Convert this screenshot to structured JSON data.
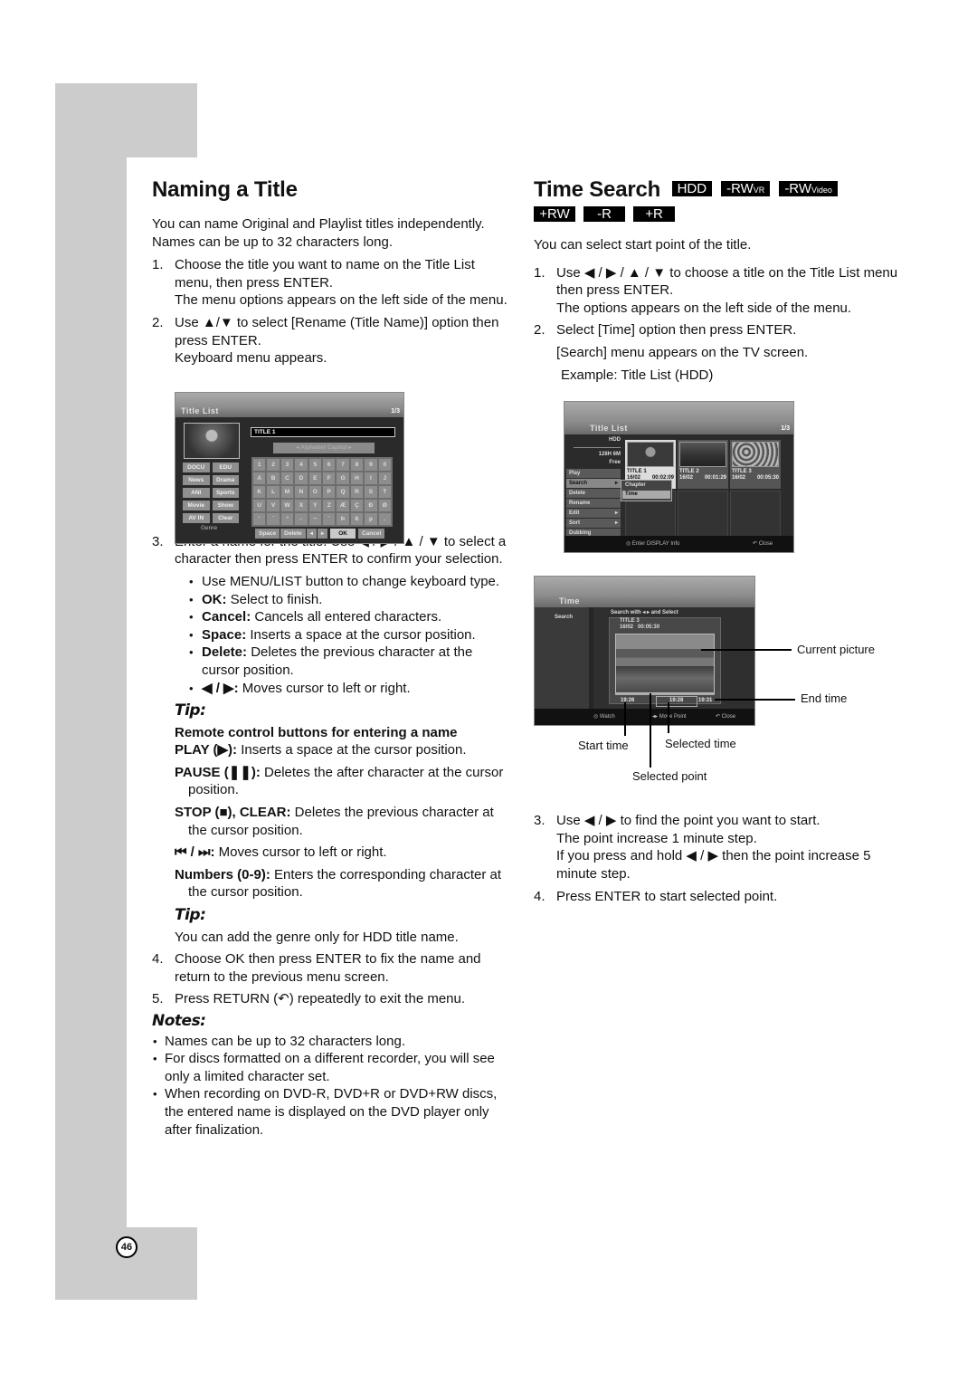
{
  "page_number": "46",
  "left": {
    "title": "Naming a Title",
    "intro": "You can name Original and Playlist titles independently. Names can be up to 32 characters long.",
    "steps": [
      {
        "num": "1.",
        "text": "Choose the title you want to name on the Title List menu, then press ENTER.",
        "sub": "The menu options appears on the left side of the menu."
      },
      {
        "num": "2.",
        "text": "Use ▲/▼ to select [Rename (Title Name)] option then press ENTER.",
        "sub": "Keyboard menu appears."
      },
      {
        "num": "3.",
        "text": "Enter a name for the title. Use ◀ / ▶ / ▲ / ▼ to select a character then press ENTER to confirm your selection."
      },
      {
        "num": "4.",
        "text": "Choose OK then press ENTER to fix the name and return to the previous menu screen."
      },
      {
        "num": "5.",
        "text": "Press RETURN (↶) repeatedly to exit the menu."
      }
    ],
    "step3_bullets": [
      {
        "bold": "",
        "text": "Use MENU/LIST button to change keyboard type."
      },
      {
        "bold": "OK:",
        "text": " Select to finish."
      },
      {
        "bold": "Cancel:",
        "text": " Cancels all entered characters."
      },
      {
        "bold": "Space:",
        "text": " Inserts a space at the cursor position."
      },
      {
        "bold": "Delete:",
        "text": " Deletes the previous character at the cursor position."
      },
      {
        "bold": "◀ / ▶:",
        "text": " Moves cursor to left or right."
      }
    ],
    "tip1": {
      "heading": "Tip:",
      "subheading": "Remote control buttons for entering a name",
      "items": [
        {
          "bold": "PLAY (▶):",
          "text": " Inserts a space at the cursor position."
        },
        {
          "bold": "PAUSE (❚❚):",
          "text": " Deletes the after character at the cursor position."
        },
        {
          "bold": "STOP (■), CLEAR:",
          "text": " Deletes the previous character at the cursor position."
        },
        {
          "bold": "⏮ / ⏭:",
          "text": " Moves cursor to left or right."
        },
        {
          "bold": "Numbers (0-9):",
          "text": " Enters the corresponding character at the cursor position."
        }
      ]
    },
    "tip2": {
      "heading": "Tip:",
      "text": "You can add the genre only for HDD title name."
    },
    "notes": {
      "heading": "Notes:",
      "items": [
        "Names can be up to 32 characters long.",
        "For discs formatted on a different recorder, you will see only a limited character set.",
        "When recording on DVD-R, DVD+R or DVD+RW discs, the entered name is displayed on the DVD player only after finalization."
      ]
    },
    "screen": {
      "title": "Title List",
      "page": "1/3",
      "name_value": "TITLE 1",
      "keyboard_type": "◂   Alphabet Capital   ▸",
      "genres": [
        "DOCU",
        "EDU",
        "News",
        "Drama",
        "ANI",
        "Sports",
        "Movie",
        "Show",
        "AV IN",
        "Clear"
      ],
      "genre_label": "Genre",
      "keys": [
        "1",
        "2",
        "3",
        "4",
        "5",
        "6",
        "7",
        "8",
        "9",
        "0",
        "A",
        "B",
        "C",
        "D",
        "E",
        "F",
        "G",
        "H",
        "I",
        "J",
        "K",
        "L",
        "M",
        "N",
        "O",
        "P",
        "Q",
        "R",
        "S",
        "T",
        "U",
        "V",
        "W",
        "X",
        "Y",
        "Z",
        "Æ",
        "Ç",
        "Ð",
        "Ø",
        "'",
        "`",
        "°",
        "←",
        "~",
        "¨",
        "Þ",
        "ß",
        "µ",
        "."
      ],
      "buttons": {
        "space": "Space",
        "delete": "Delete",
        "left": "◂",
        "right": "▸",
        "ok": "OK",
        "cancel": "Cancel"
      }
    }
  },
  "right": {
    "title": "Time Search",
    "badges": [
      "HDD",
      "-RW",
      "-RW",
      "+RW",
      "-R",
      "+R"
    ],
    "badge_subs": [
      "",
      "VR",
      "Video",
      "",
      "",
      ""
    ],
    "intro": "You can select start point of the title.",
    "steps": [
      {
        "num": "1.",
        "text": "Use ◀ / ▶ / ▲ / ▼ to choose a title on the Title List menu then press ENTER.",
        "sub": "The options appears on the left side of the menu."
      },
      {
        "num": "2.",
        "text": "Select [Time] option then press ENTER.",
        "sub": "[Search] menu appears on the TV screen.",
        "sub2": "Example: Title List (HDD)"
      },
      {
        "num": "3.",
        "text": "Use ◀ / ▶ to find the point you want to start.",
        "sub": "The point increase 1 minute step.",
        "sub2": "If you press and hold ◀ / ▶ then the point increase 5 minute step."
      },
      {
        "num": "4.",
        "text": "Press ENTER to start selected point."
      }
    ],
    "title_list_screen": {
      "title": "Title List",
      "page": "1/3",
      "storage": "HDD",
      "free_space": "128H 6M",
      "free_label": "Free",
      "options": [
        "Play",
        "Search",
        "Delete",
        "Rename",
        "Edit",
        "Sort",
        "Dubbing"
      ],
      "submenu": [
        "Chapter",
        "Time"
      ],
      "titles": [
        {
          "name": "TITLE 1",
          "date": "16/02",
          "duration": "00:02:09"
        },
        {
          "name": "TITLE 2",
          "date": "16/02",
          "duration": "00:01:29"
        },
        {
          "name": "TITLE 3",
          "date": "16/02",
          "duration": "00:05:30"
        }
      ],
      "footer_enter": "◎ Enter  DISPLAY  Info",
      "footer_close": "↶ Close"
    },
    "time_screen": {
      "title": "Time",
      "left_item": "Search",
      "hint": "Search with ◂ ▸ and Select",
      "title_name": "TITLE 3",
      "title_date": "16/02",
      "title_duration": "00:05:30",
      "start_time": "19:26",
      "selected_time": "19:28",
      "end_time": "19:31",
      "footer_watch": "◎ Watch",
      "footer_move": "◂▸ Move Point",
      "footer_close": "↶ Close"
    },
    "callouts": {
      "current_picture": "Current picture",
      "end_time": "End time",
      "start_time": "Start time",
      "selected_time": "Selected time",
      "selected_point": "Selected point"
    }
  }
}
